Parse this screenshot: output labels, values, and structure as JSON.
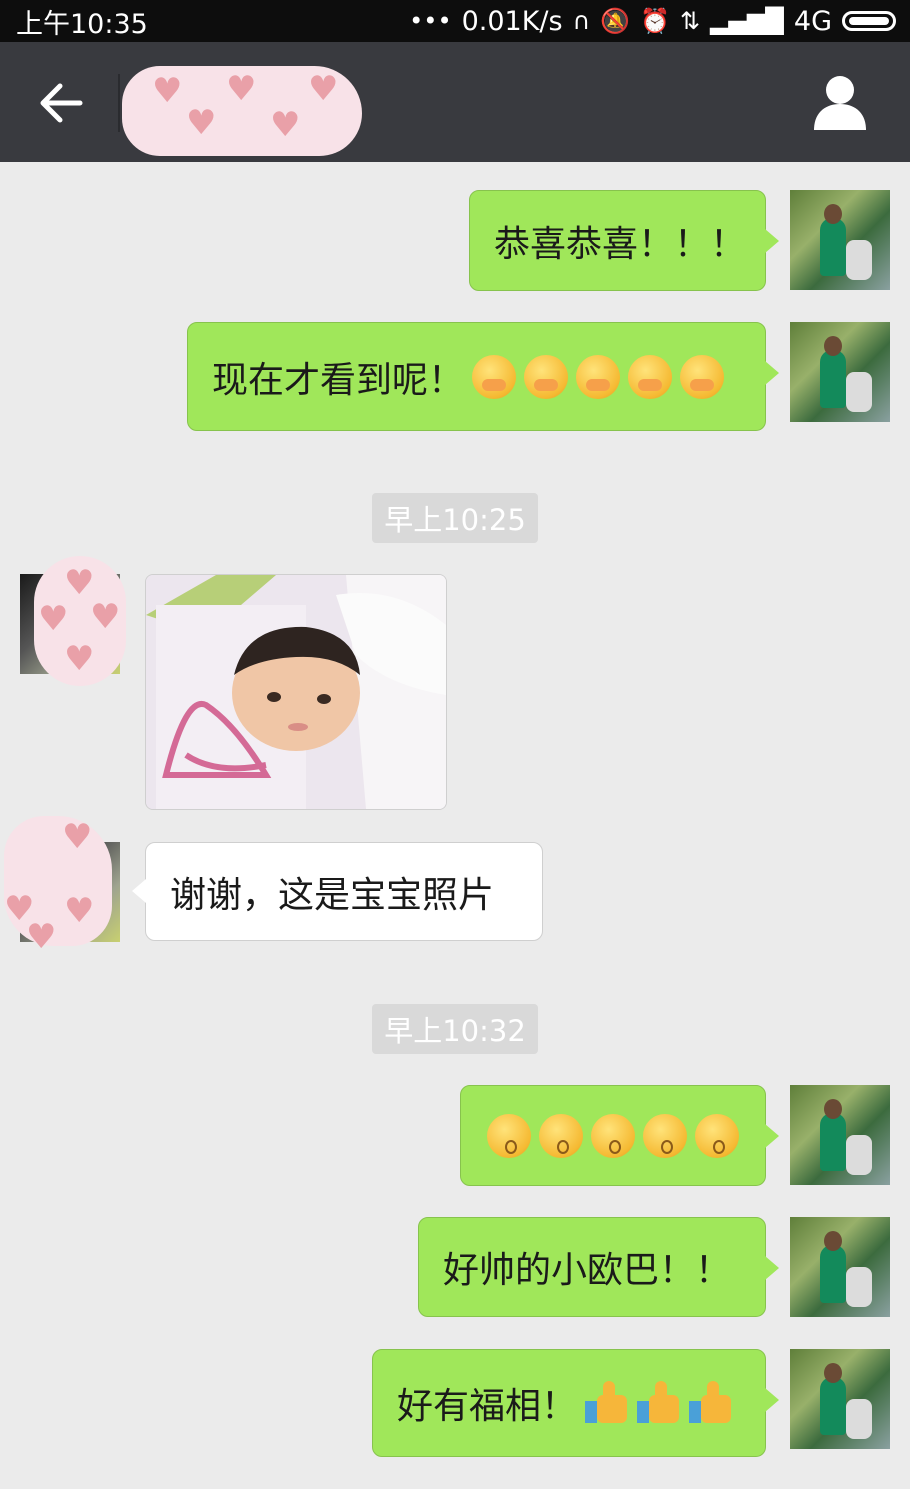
{
  "status_bar": {
    "time": "上午10:35",
    "speed": "0.01K/s",
    "network": "4G"
  },
  "header": {
    "back_icon": "arrow-left-icon",
    "profile_icon": "person-icon"
  },
  "messages": [
    {
      "from": "me",
      "text": "恭喜恭喜！！！"
    },
    {
      "from": "me",
      "text": "现在才看到呢！",
      "emoji": "hugging-face x5"
    },
    {
      "timestamp": "早上10:25"
    },
    {
      "from": "other",
      "type": "image",
      "alt": "baby photo"
    },
    {
      "from": "other",
      "text": "谢谢，这是宝宝照片"
    },
    {
      "timestamp": "早上10:32"
    },
    {
      "from": "me",
      "emoji": "kissing-face x5"
    },
    {
      "from": "me",
      "text": "好帅的小欧巴！！"
    },
    {
      "from": "me",
      "text": "好有福相！",
      "emoji": "thumbs-up x3"
    }
  ],
  "colors": {
    "my_bubble": "#a0e75a",
    "their_bubble": "#ffffff",
    "title_bar": "#393a3f",
    "background": "#ebebeb"
  }
}
